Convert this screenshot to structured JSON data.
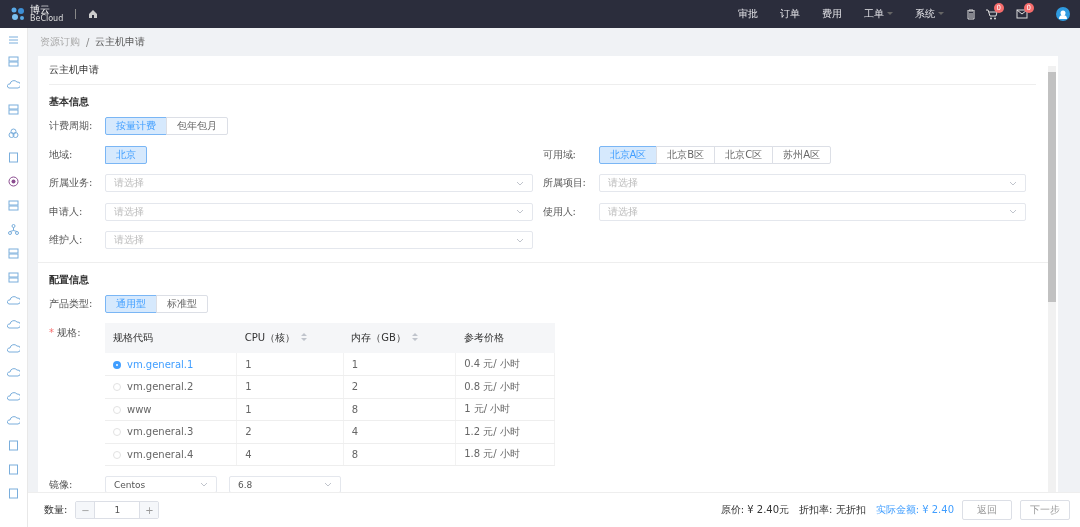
{
  "topbar": {
    "logo_title": "博云",
    "logo_subtitle": "BeCloud",
    "nav": [
      {
        "label": "审批",
        "dropdown": false
      },
      {
        "label": "订单",
        "dropdown": false
      },
      {
        "label": "费用",
        "dropdown": false
      },
      {
        "label": "工单",
        "dropdown": true
      },
      {
        "label": "系统",
        "dropdown": true
      }
    ],
    "cart_badge": "0",
    "mail_badge": "0"
  },
  "breadcrumb": [
    "资源订购",
    "/",
    "云主机申请"
  ],
  "card_title": "云主机申请",
  "basic": {
    "title": "基本信息",
    "billing": {
      "label": "计费周期:",
      "options": [
        {
          "label": "按量计费",
          "selected": true
        },
        {
          "label": "包年包月",
          "selected": false
        }
      ]
    },
    "region": {
      "label": "地域:",
      "options": [
        {
          "label": "北京",
          "selected": true
        }
      ]
    },
    "zone": {
      "label": "可用域:",
      "options": [
        {
          "label": "北京A区",
          "selected": true
        },
        {
          "label": "北京B区",
          "selected": false
        },
        {
          "label": "北京C区",
          "selected": false
        },
        {
          "label": "苏州A区",
          "selected": false
        }
      ]
    },
    "selects": [
      {
        "label": "所属业务:",
        "placeholder": "请选择"
      },
      {
        "label": "所属项目:",
        "placeholder": "请选择"
      },
      {
        "label": "申请人:",
        "placeholder": "请选择"
      },
      {
        "label": "使用人:",
        "placeholder": "请选择"
      },
      {
        "label": "维护人:",
        "placeholder": "请选择"
      }
    ]
  },
  "config": {
    "title": "配置信息",
    "product_type": {
      "label": "产品类型:",
      "options": [
        {
          "label": "通用型",
          "selected": true
        },
        {
          "label": "标准型",
          "selected": false
        }
      ]
    },
    "spec": {
      "required_mark": "*",
      "label": "规格:",
      "columns": [
        {
          "label": "规格代码",
          "sortable": false
        },
        {
          "label": "CPU（核）",
          "sortable": true
        },
        {
          "label": "内存（GB）",
          "sortable": true
        },
        {
          "label": "参考价格",
          "sortable": false
        }
      ],
      "rows": [
        {
          "code": "vm.general.1",
          "cpu": "1",
          "memory": "1",
          "price": "0.4 元/ 小时",
          "selected": true
        },
        {
          "code": "vm.general.2",
          "cpu": "1",
          "memory": "2",
          "price": "0.8 元/ 小时",
          "selected": false
        },
        {
          "code": "www",
          "cpu": "1",
          "memory": "8",
          "price": "1 元/ 小时",
          "selected": false
        },
        {
          "code": "vm.general.3",
          "cpu": "2",
          "memory": "4",
          "price": "1.2 元/ 小时",
          "selected": false
        },
        {
          "code": "vm.general.4",
          "cpu": "4",
          "memory": "8",
          "price": "1.8 元/ 小时",
          "selected": false
        }
      ]
    },
    "image": {
      "label": "镜像:",
      "os": "Centos",
      "version": "6.8"
    }
  },
  "footer": {
    "quantity_label": "数量:",
    "minus": "−",
    "quantity": "1",
    "plus": "+",
    "original_price": "原价: ¥ 2.40元",
    "discount": "折扣率: 无折扣",
    "actual": "实际金额: ¥ 2.40",
    "buttons": [
      "返回",
      "下一步"
    ]
  }
}
